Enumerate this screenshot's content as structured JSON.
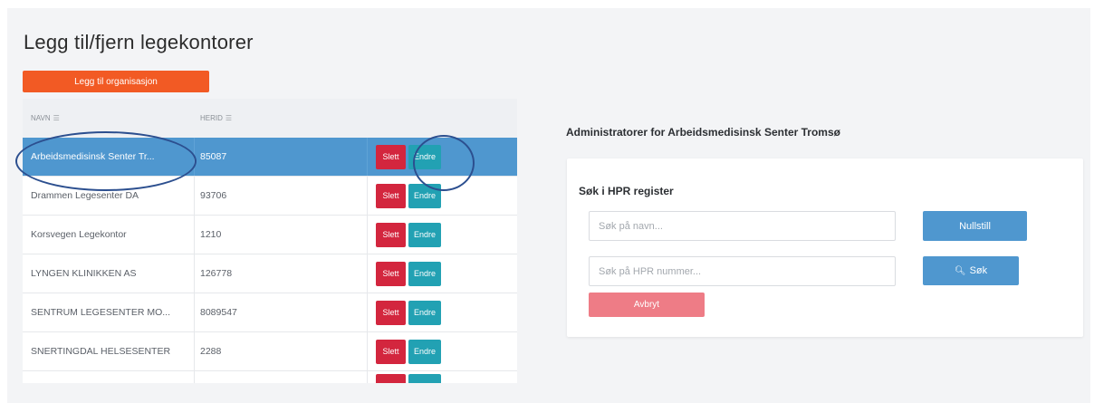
{
  "page": {
    "title": "Legg til/fjern legekontorer",
    "add_button": "Legg til organisasjon"
  },
  "table": {
    "headers": {
      "name": "NAVN",
      "hero": "HERID"
    },
    "actions": {
      "delete": "Slett",
      "edit": "Endre"
    },
    "rows": [
      {
        "name": "Arbeidsmedisinsk Senter Tr...",
        "herid": "85087",
        "selected": true
      },
      {
        "name": "Drammen Legesenter DA",
        "herid": "93706",
        "selected": false
      },
      {
        "name": "Korsvegen Legekontor",
        "herid": "1210",
        "selected": false
      },
      {
        "name": "LYNGEN KLINIKKEN AS",
        "herid": "126778",
        "selected": false
      },
      {
        "name": "SENTRUM LEGESENTER MO...",
        "herid": "8089547",
        "selected": false
      },
      {
        "name": "SNERTINGDAL HELSESENTER",
        "herid": "2288",
        "selected": false
      }
    ]
  },
  "admin": {
    "title": "Administratorer for Arbeidsmedisinsk Senter Tromsø",
    "search_title": "Søk i HPR register",
    "name_placeholder": "Søk på navn...",
    "hpr_placeholder": "Søk på HPR nummer...",
    "reset_label": "Nullstill",
    "search_label": "Søk",
    "cancel_label": "Avbryt"
  },
  "colors": {
    "accent_orange": "#f25a24",
    "selected_row": "#4f97cf",
    "delete_red": "#d3263e",
    "edit_teal": "#22a1b3",
    "cancel_pink": "#ee7c86",
    "annotation": "#2c4f8f"
  }
}
